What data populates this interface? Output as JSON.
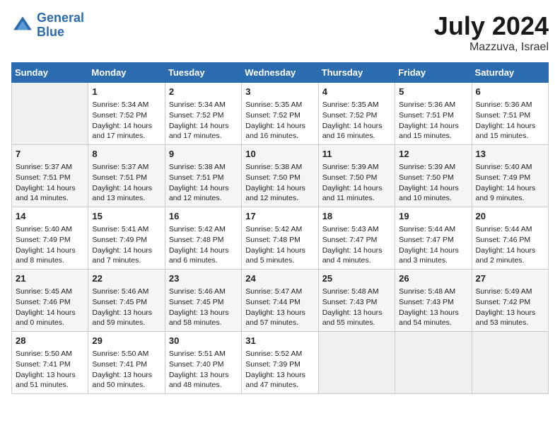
{
  "header": {
    "logo_line1": "General",
    "logo_line2": "Blue",
    "month_year": "July 2024",
    "location": "Mazzuva, Israel"
  },
  "weekdays": [
    "Sunday",
    "Monday",
    "Tuesday",
    "Wednesday",
    "Thursday",
    "Friday",
    "Saturday"
  ],
  "weeks": [
    [
      {
        "day": "",
        "info": ""
      },
      {
        "day": "1",
        "info": "Sunrise: 5:34 AM\nSunset: 7:52 PM\nDaylight: 14 hours\nand 17 minutes."
      },
      {
        "day": "2",
        "info": "Sunrise: 5:34 AM\nSunset: 7:52 PM\nDaylight: 14 hours\nand 17 minutes."
      },
      {
        "day": "3",
        "info": "Sunrise: 5:35 AM\nSunset: 7:52 PM\nDaylight: 14 hours\nand 16 minutes."
      },
      {
        "day": "4",
        "info": "Sunrise: 5:35 AM\nSunset: 7:52 PM\nDaylight: 14 hours\nand 16 minutes."
      },
      {
        "day": "5",
        "info": "Sunrise: 5:36 AM\nSunset: 7:51 PM\nDaylight: 14 hours\nand 15 minutes."
      },
      {
        "day": "6",
        "info": "Sunrise: 5:36 AM\nSunset: 7:51 PM\nDaylight: 14 hours\nand 15 minutes."
      }
    ],
    [
      {
        "day": "7",
        "info": "Sunrise: 5:37 AM\nSunset: 7:51 PM\nDaylight: 14 hours\nand 14 minutes."
      },
      {
        "day": "8",
        "info": "Sunrise: 5:37 AM\nSunset: 7:51 PM\nDaylight: 14 hours\nand 13 minutes."
      },
      {
        "day": "9",
        "info": "Sunrise: 5:38 AM\nSunset: 7:51 PM\nDaylight: 14 hours\nand 12 minutes."
      },
      {
        "day": "10",
        "info": "Sunrise: 5:38 AM\nSunset: 7:50 PM\nDaylight: 14 hours\nand 12 minutes."
      },
      {
        "day": "11",
        "info": "Sunrise: 5:39 AM\nSunset: 7:50 PM\nDaylight: 14 hours\nand 11 minutes."
      },
      {
        "day": "12",
        "info": "Sunrise: 5:39 AM\nSunset: 7:50 PM\nDaylight: 14 hours\nand 10 minutes."
      },
      {
        "day": "13",
        "info": "Sunrise: 5:40 AM\nSunset: 7:49 PM\nDaylight: 14 hours\nand 9 minutes."
      }
    ],
    [
      {
        "day": "14",
        "info": "Sunrise: 5:40 AM\nSunset: 7:49 PM\nDaylight: 14 hours\nand 8 minutes."
      },
      {
        "day": "15",
        "info": "Sunrise: 5:41 AM\nSunset: 7:49 PM\nDaylight: 14 hours\nand 7 minutes."
      },
      {
        "day": "16",
        "info": "Sunrise: 5:42 AM\nSunset: 7:48 PM\nDaylight: 14 hours\nand 6 minutes."
      },
      {
        "day": "17",
        "info": "Sunrise: 5:42 AM\nSunset: 7:48 PM\nDaylight: 14 hours\nand 5 minutes."
      },
      {
        "day": "18",
        "info": "Sunrise: 5:43 AM\nSunset: 7:47 PM\nDaylight: 14 hours\nand 4 minutes."
      },
      {
        "day": "19",
        "info": "Sunrise: 5:44 AM\nSunset: 7:47 PM\nDaylight: 14 hours\nand 3 minutes."
      },
      {
        "day": "20",
        "info": "Sunrise: 5:44 AM\nSunset: 7:46 PM\nDaylight: 14 hours\nand 2 minutes."
      }
    ],
    [
      {
        "day": "21",
        "info": "Sunrise: 5:45 AM\nSunset: 7:46 PM\nDaylight: 14 hours\nand 0 minutes."
      },
      {
        "day": "22",
        "info": "Sunrise: 5:46 AM\nSunset: 7:45 PM\nDaylight: 13 hours\nand 59 minutes."
      },
      {
        "day": "23",
        "info": "Sunrise: 5:46 AM\nSunset: 7:45 PM\nDaylight: 13 hours\nand 58 minutes."
      },
      {
        "day": "24",
        "info": "Sunrise: 5:47 AM\nSunset: 7:44 PM\nDaylight: 13 hours\nand 57 minutes."
      },
      {
        "day": "25",
        "info": "Sunrise: 5:48 AM\nSunset: 7:43 PM\nDaylight: 13 hours\nand 55 minutes."
      },
      {
        "day": "26",
        "info": "Sunrise: 5:48 AM\nSunset: 7:43 PM\nDaylight: 13 hours\nand 54 minutes."
      },
      {
        "day": "27",
        "info": "Sunrise: 5:49 AM\nSunset: 7:42 PM\nDaylight: 13 hours\nand 53 minutes."
      }
    ],
    [
      {
        "day": "28",
        "info": "Sunrise: 5:50 AM\nSunset: 7:41 PM\nDaylight: 13 hours\nand 51 minutes."
      },
      {
        "day": "29",
        "info": "Sunrise: 5:50 AM\nSunset: 7:41 PM\nDaylight: 13 hours\nand 50 minutes."
      },
      {
        "day": "30",
        "info": "Sunrise: 5:51 AM\nSunset: 7:40 PM\nDaylight: 13 hours\nand 48 minutes."
      },
      {
        "day": "31",
        "info": "Sunrise: 5:52 AM\nSunset: 7:39 PM\nDaylight: 13 hours\nand 47 minutes."
      },
      {
        "day": "",
        "info": ""
      },
      {
        "day": "",
        "info": ""
      },
      {
        "day": "",
        "info": ""
      }
    ]
  ]
}
